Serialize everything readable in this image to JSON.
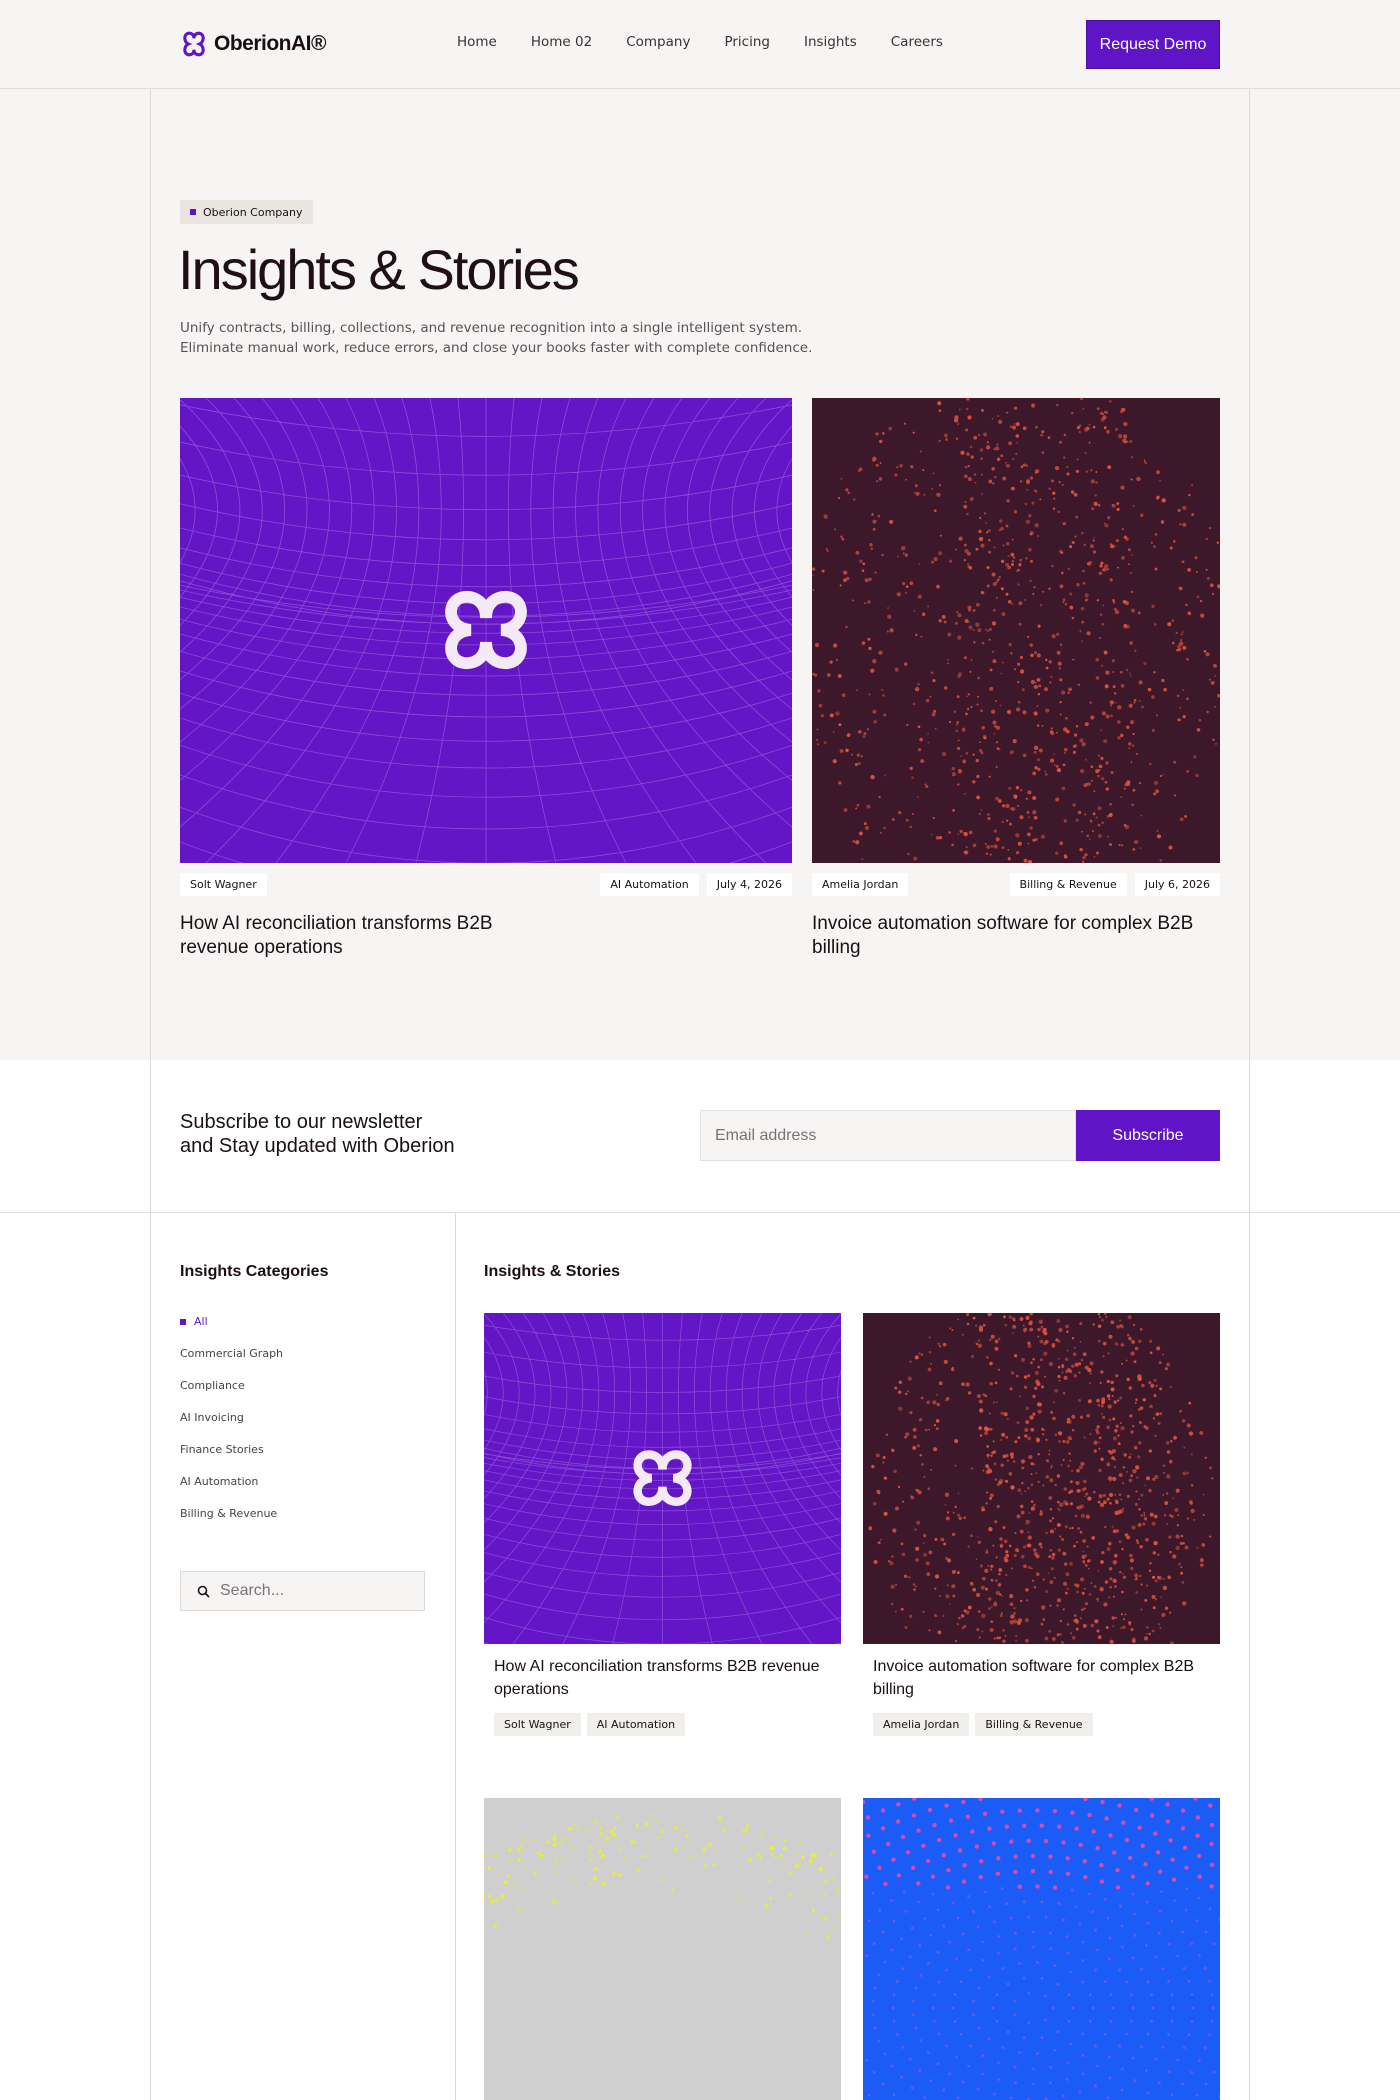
{
  "brand": {
    "name": "OberionAI®",
    "accent": "#5f14c8"
  },
  "nav": [
    "Home",
    "Home 02",
    "Company",
    "Pricing",
    "Insights",
    "Careers"
  ],
  "header": {
    "cta": "Request Demo"
  },
  "hero": {
    "badge": "Oberion Company",
    "title": "Insights & Stories",
    "description": "Unify contracts, billing, collections, and revenue recognition into a single intelligent system. Eliminate manual work, reduce errors, and close your books faster with complete confidence."
  },
  "featured": [
    {
      "author": "Solt Wagner",
      "category": "AI Automation",
      "date": "July 4, 2026",
      "title": "How AI reconciliation transforms B2B revenue operations",
      "image": "purple-grid-logo"
    },
    {
      "author": "Amelia Jordan",
      "category": "Billing & Revenue",
      "date": "July 6, 2026",
      "title": "Invoice automation software for complex B2B billing",
      "image": "maroon-dot-globe"
    }
  ],
  "newsletter": {
    "title_line1": "Subscribe to our newsletter",
    "title_line2": "and Stay updated with Oberion",
    "placeholder": "Email address",
    "button": "Subscribe"
  },
  "sidebar": {
    "title": "Insights Categories",
    "categories": [
      "All",
      "Commercial Graph",
      "Compliance",
      "AI Invoicing",
      "Finance Stories",
      "AI Automation",
      "Billing & Revenue"
    ],
    "active": "All",
    "search_placeholder": "Search..."
  },
  "grid": {
    "title": "Insights & Stories",
    "posts": [
      {
        "title": "How AI reconciliation transforms B2B revenue operations",
        "author": "Solt Wagner",
        "category": "AI Automation",
        "image": "purple-grid-logo"
      },
      {
        "title": "Invoice automation software for complex B2B billing",
        "author": "Amelia Jordan",
        "category": "Billing & Revenue",
        "image": "maroon-dot-globe"
      },
      {
        "image": "grey-yellow-globe"
      },
      {
        "image": "blue-dot-rings"
      }
    ]
  }
}
